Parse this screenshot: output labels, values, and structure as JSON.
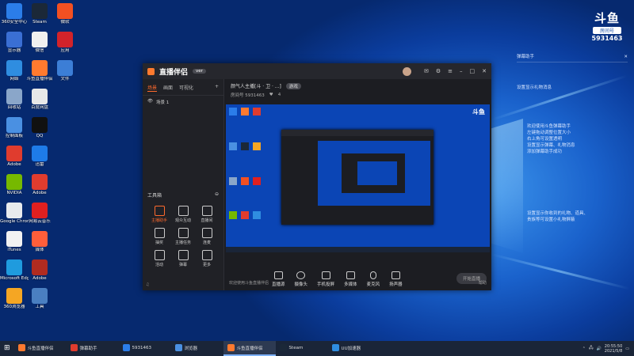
{
  "desktop_icons": [
    {
      "label": "360安全中心",
      "color": "#2b7de9"
    },
    {
      "label": "显示器",
      "color": "#3a6fd4"
    },
    {
      "label": "网络",
      "color": "#2f8de0"
    },
    {
      "label": "回收站",
      "color": "#8aa6c9"
    },
    {
      "label": "控制面板",
      "color": "#4a90e2"
    },
    {
      "label": "Adobe",
      "color": "#e03c2e"
    },
    {
      "label": "NVIDIA",
      "color": "#76b900"
    },
    {
      "label": "Google Chrome",
      "color": "#e8eaed"
    },
    {
      "label": "iTunes",
      "color": "#f2f2f2"
    },
    {
      "label": "Microsoft Edge",
      "color": "#1f9bde"
    },
    {
      "label": "360浏览器",
      "color": "#f5a623"
    },
    {
      "label": "Steam",
      "color": "#1b2838"
    },
    {
      "label": "微信",
      "color": "#f0f0f0"
    },
    {
      "label": "斗鱼直播伴侣",
      "color": "#ff7a2f"
    },
    {
      "label": "百度网盘",
      "color": "#e8e8e8"
    },
    {
      "label": "QQ",
      "color": "#111"
    },
    {
      "label": "迅雷",
      "color": "#1e7be8"
    },
    {
      "label": "Adobe",
      "color": "#e03c2e"
    },
    {
      "label": "网易云音乐",
      "color": "#e02020"
    },
    {
      "label": "媒体",
      "color": "#ff5e3a"
    },
    {
      "label": "Adobe",
      "color": "#b02b20"
    },
    {
      "label": "工具",
      "color": "#4a7fc1"
    },
    {
      "label": "微软",
      "color": "#f25022"
    },
    {
      "label": "应用",
      "color": "#d2232a"
    },
    {
      "label": "文件",
      "color": "#3c7ed6"
    }
  ],
  "room": {
    "label": "房间号",
    "number": "5931463"
  },
  "app": {
    "title": "直播伴侣",
    "badge": "ver",
    "left_tabs": [
      "场景",
      "画面",
      "可视化"
    ],
    "scene_label": "场景 1",
    "tools_title": "工具箱",
    "tools": [
      "主播助手",
      "观众互动",
      "直播间",
      "抽奖",
      "主播任务",
      "连麦",
      "活动",
      "弹幕",
      "更多"
    ],
    "stream_title": "颜气人主播[斗 · 卫 · ...]",
    "stream_tag": "游戏",
    "room_info": "房间号 5931463",
    "fans": "4",
    "controls": [
      "直播源",
      "摄像头",
      "手机投屏",
      "多媒体",
      "麦克风",
      "扬声器"
    ],
    "start_label": "开始直播",
    "footer_left": "欢迎使用斗鱼直播伴侣",
    "footer_right": "帮助"
  },
  "right_panel": {
    "title": "弹幕助手",
    "line1": "设置显示礼物消息",
    "welcome": [
      "欢迎使用斗鱼弹幕助手",
      "左键拖动调整位置大小",
      "右上角可设置透明",
      "设置显示弹幕、礼物消息",
      "添加弹幕助手成功"
    ],
    "gift": [
      "设置显示你收到的礼物、道具、",
      "贵族等可设置小礼物屏蔽"
    ]
  },
  "taskbar": [
    {
      "label": "斗鱼直播伴侣",
      "active": false,
      "color": "#ff7a2f"
    },
    {
      "label": "弹幕助手",
      "active": false,
      "color": "#e03c2e"
    },
    {
      "label": "5931463",
      "active": false,
      "color": "#2b7de9"
    },
    {
      "label": "浏览器",
      "active": false,
      "color": "#4a90e2"
    },
    {
      "label": "斗鱼直播伴侣",
      "active": true,
      "color": "#ff7a2f"
    },
    {
      "label": "Steam",
      "active": false,
      "color": "#1b2838"
    },
    {
      "label": "UU加速器",
      "active": false,
      "color": "#2f8de0"
    }
  ],
  "clock": {
    "time": "20:55:50",
    "date": "2021/5/8"
  }
}
